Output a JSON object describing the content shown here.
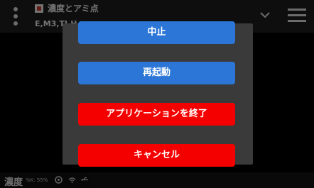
{
  "app": {
    "title": "濃度とアミ点",
    "subtitle": "E,M3,TI,H..."
  },
  "status": {
    "label": "濃度",
    "value": "%K: 55%"
  },
  "dialog": {
    "buttons": {
      "stop": "中止",
      "restart": "再起動",
      "quit": "アプリケーションを終了",
      "cancel": "キャンセル"
    }
  },
  "colors": {
    "primary_blue": "#2b76d6",
    "danger_red": "#f40000",
    "dialog_bg": "#3a3a3a"
  },
  "icons": [
    "kebab-menu-icon",
    "app-icon",
    "chevron-down-icon",
    "hamburger-menu-icon",
    "gauge-icon",
    "wifi-icon",
    "usb-icon"
  ]
}
